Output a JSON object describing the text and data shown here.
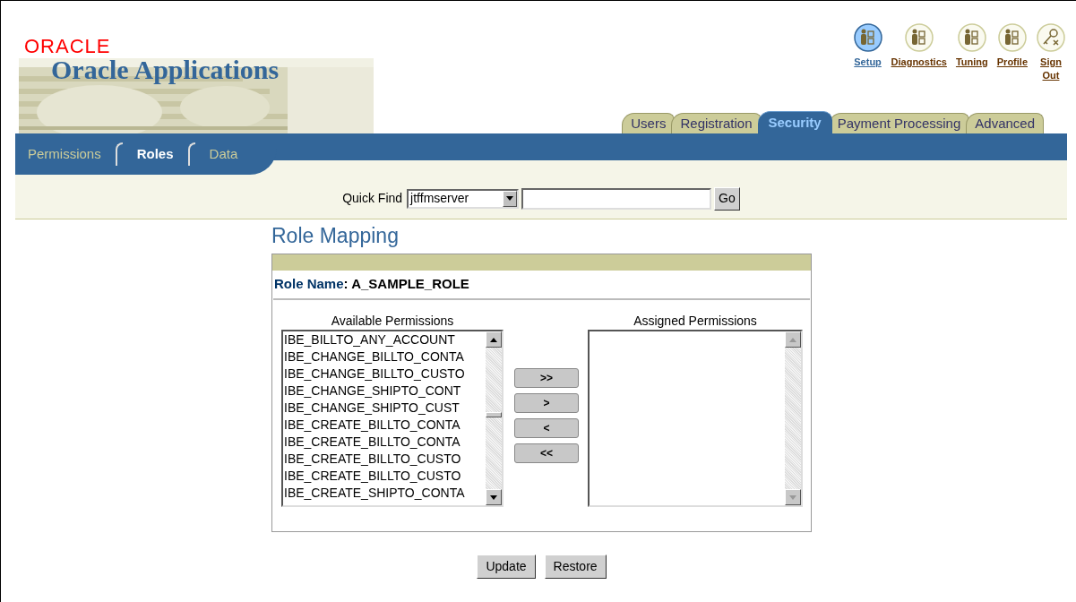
{
  "branding": {
    "company": "ORACLE",
    "product": "Oracle Applications"
  },
  "global_links": [
    {
      "label": "Setup",
      "kind": "person",
      "selected": true
    },
    {
      "label": "Diagnostics",
      "kind": "person",
      "selected": false
    },
    {
      "label": "Tuning",
      "kind": "person",
      "selected": false
    },
    {
      "label": "Profile",
      "kind": "person",
      "selected": false
    },
    {
      "label": "Sign Out",
      "kind": "key",
      "selected": false
    }
  ],
  "tabs": [
    {
      "label": "Users",
      "selected": false
    },
    {
      "label": "Registration",
      "selected": false
    },
    {
      "label": "Security",
      "selected": true
    },
    {
      "label": "Payment Processing",
      "selected": false
    },
    {
      "label": "Advanced",
      "selected": false
    }
  ],
  "subtabs": [
    {
      "label": "Permissions",
      "selected": false
    },
    {
      "label": "Roles",
      "selected": true
    },
    {
      "label": "Data",
      "selected": false
    }
  ],
  "quick_find": {
    "label": "Quick Find",
    "selected_option": "jtffmserver",
    "button": "Go"
  },
  "page_title": "Role Mapping",
  "role": {
    "text": "**Role Name**: A_SAMPLE_ROLE"
  },
  "available": {
    "heading": "Available Permissions",
    "items": [
      "IBE_BILLTO_ANY_ACCOUNT",
      "IBE_CHANGE_BILLTO_CONTA",
      "IBE_CHANGE_BILLTO_CUSTO",
      "IBE_CHANGE_SHIPTO_CONT",
      "IBE_CHANGE_SHIPTO_CUST",
      "IBE_CREATE_BILLTO_CONTA",
      "IBE_CREATE_BILLTO_CONTA",
      "IBE_CREATE_BILLTO_CUSTO",
      "IBE_CREATE_BILLTO_CUSTO",
      "IBE_CREATE_SHIPTO_CONTA"
    ]
  },
  "move_buttons": [
    ">>",
    ">",
    "<",
    "<<"
  ],
  "assigned": {
    "heading": "Assigned Permissions"
  },
  "buttons": [
    "Update",
    "Restore"
  ]
}
